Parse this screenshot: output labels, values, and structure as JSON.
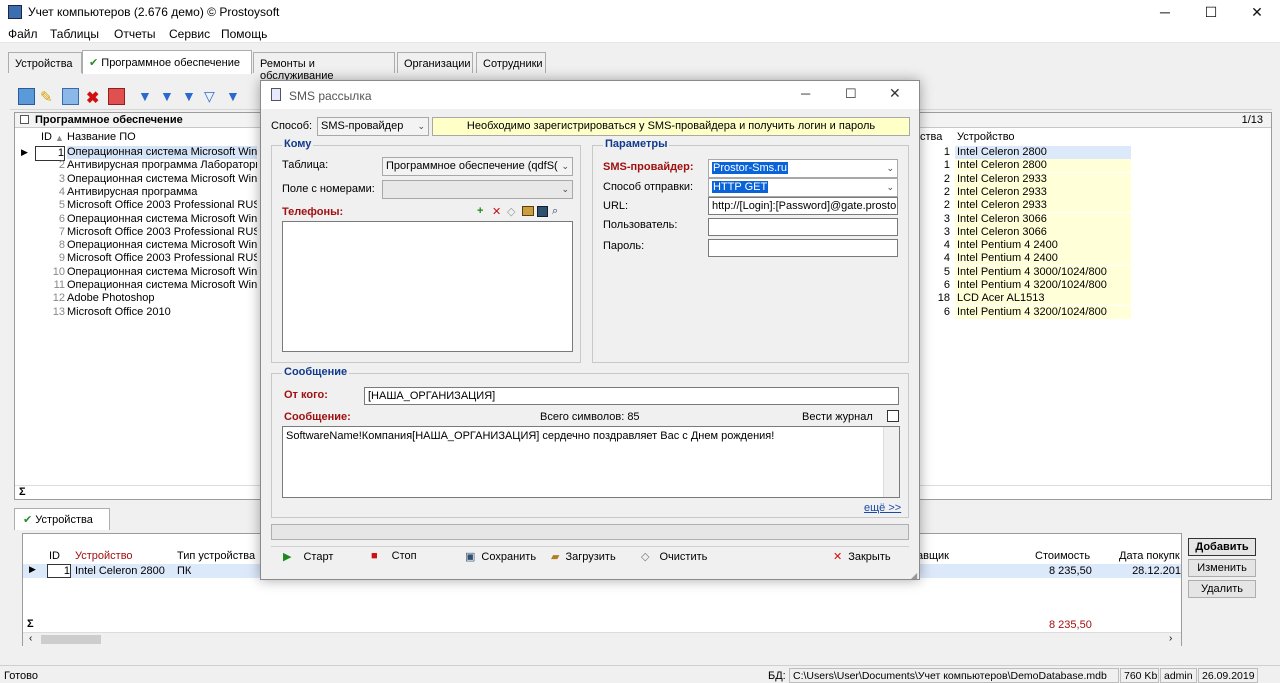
{
  "window": {
    "title": "Учет компьютеров (2.676 демо) © Prostoysoft",
    "min": "─",
    "max": "☐",
    "close": "✕"
  },
  "menu": [
    "Файл",
    "Таблицы",
    "Отчеты",
    "Сервис",
    "Помощь"
  ],
  "tabs": [
    "Устройства",
    "Программное обеспечение",
    "Ремонты и обслуживание",
    "Организации",
    "Сотрудники"
  ],
  "main_grid": {
    "title": "Программное обеспечение",
    "page": "1/13",
    "col_id": "ID",
    "col_name": "Название ПО",
    "col_qty": "ства",
    "col_device": "Устройство",
    "sigma": "Σ",
    "rows": [
      {
        "id": "1",
        "name": "Операционная система Microsoft Windo",
        "qty": "1",
        "device": "Intel Celeron 2800"
      },
      {
        "id": "2",
        "name": "Антивирусная программа Лаборатори",
        "qty": "1",
        "device": "Intel Celeron 2800"
      },
      {
        "id": "3",
        "name": "Операционная система Microsoft Windo",
        "qty": "2",
        "device": "Intel Celeron 2933"
      },
      {
        "id": "4",
        "name": "Антивирусная программа",
        "qty": "2",
        "device": "Intel Celeron 2933"
      },
      {
        "id": "5",
        "name": "Microsoft Office 2003 Professional RUS",
        "qty": "2",
        "device": "Intel Celeron 2933"
      },
      {
        "id": "6",
        "name": "Операционная система Microsoft Windo",
        "qty": "3",
        "device": "Intel Celeron 3066"
      },
      {
        "id": "7",
        "name": "Microsoft Office 2003 Professional RUS",
        "qty": "3",
        "device": "Intel Celeron 3066"
      },
      {
        "id": "8",
        "name": "Операционная система Microsoft Windo",
        "qty": "4",
        "device": "Intel Pentium 4 2400"
      },
      {
        "id": "9",
        "name": "Microsoft Office 2003 Professional RUS",
        "qty": "4",
        "device": "Intel Pentium 4 2400"
      },
      {
        "id": "10",
        "name": "Операционная система Microsoft Windo",
        "qty": "5",
        "device": "Intel Pentium 4 3000/1024/800"
      },
      {
        "id": "11",
        "name": "Операционная система Microsoft Windo",
        "qty": "6",
        "device": "Intel Pentium 4 3200/1024/800"
      },
      {
        "id": "12",
        "name": "Adobe Photoshop",
        "qty": "18",
        "device": "LCD Acer AL1513"
      },
      {
        "id": "13",
        "name": "Microsoft Office 2010",
        "qty": "6",
        "device": "Intel Pentium 4 3200/1024/800"
      }
    ]
  },
  "bottom": {
    "tab": "Устройства",
    "col_id": "ID",
    "col_device": "Устройство",
    "col_type": "Тип устройства",
    "col_supplier": "авщик",
    "col_cost": "Стоимость",
    "col_date": "Дата покупк",
    "row": {
      "id": "1",
      "device": "Intel Celeron 2800",
      "type": "ПК",
      "cost": "8 235,50",
      "date": "28.12.201"
    },
    "sum_cost": "8 235,50",
    "sigma": "Σ",
    "btn_add": "Добавить",
    "btn_edit": "Изменить",
    "btn_delete": "Удалить"
  },
  "status": {
    "left": "Готово",
    "db_label": "БД:",
    "db_path": "C:\\Users\\User\\Documents\\Учет компьютеров\\DemoDatabase.mdb",
    "size": "760 Kb",
    "user": "admin",
    "date": "26.09.2019"
  },
  "dialog": {
    "title": "SMS рассылка",
    "method_label": "Способ:",
    "method_value": "SMS-провайдер",
    "method_note": "Необходимо зарегистрироваться у SMS-провайдера и получить логин и пароль",
    "to": {
      "title": "Кому",
      "table_label": "Таблица:",
      "table_value": "Программное обеспечение (qdfS(",
      "phonefield_label": "Поле с номерами:",
      "phones_label": "Телефоны:"
    },
    "params": {
      "title": "Параметры",
      "provider_label": "SMS-провайдер:",
      "provider_value": "Prostor-Sms.ru",
      "send_label": "Способ отправки:",
      "send_value": "HTTP GET",
      "url_label": "URL:",
      "url_value": "http://[Login]:[Password]@gate.prostor",
      "user_label": "Пользователь:",
      "pass_label": "Пароль:"
    },
    "message": {
      "title": "Сообщение",
      "from_label": "От кого:",
      "from_value": "[НАША_ОРГАНИЗАЦИЯ]",
      "msg_label": "Сообщение:",
      "count": "Всего символов: 85",
      "log_label": "Вести журнал",
      "text": "SoftwareName!Компания[НАША_ОРГАНИЗАЦИЯ] сердечно поздравляет Вас с Днем рождения!",
      "more": "ещё >>"
    },
    "buttons": {
      "start": "Старт",
      "stop": "Стоп",
      "save": "Сохранить",
      "load": "Загрузить",
      "clear": "Очистить",
      "close": "Закрыть"
    }
  }
}
